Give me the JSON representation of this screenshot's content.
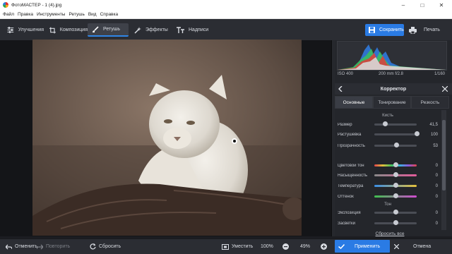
{
  "window": {
    "title": "ФотоМАСТЕР - 1 (4).jpg",
    "controls": [
      "–",
      "□",
      "✕"
    ]
  },
  "menu": [
    "Файл",
    "Правка",
    "Инструменты",
    "Ретушь",
    "Вид",
    "Справка"
  ],
  "toolbar": {
    "tabs": [
      {
        "label": "Улучшения",
        "icon": "enhance-icon",
        "active": false
      },
      {
        "label": "Композиция",
        "icon": "crop-icon",
        "active": false
      },
      {
        "label": "Ретушь",
        "icon": "brush-icon",
        "active": true
      },
      {
        "label": "Эффекты",
        "icon": "magic-wand-icon",
        "active": false
      },
      {
        "label": "Надписи",
        "icon": "text-icon",
        "active": false
      }
    ],
    "save_label": "Сохранить",
    "print_label": "Печать"
  },
  "photo_info": {
    "iso": "ISO 400",
    "lens": "200 mm f/2.8",
    "shutter": "1/160"
  },
  "panel": {
    "title": "Корректор",
    "subtabs": [
      {
        "label": "Основные",
        "active": true
      },
      {
        "label": "Тонирование",
        "active": false
      },
      {
        "label": "Резкость",
        "active": false
      }
    ],
    "section_brush": "Кисть",
    "brush_sliders": [
      {
        "label": "Размер",
        "value": "41,5",
        "level": 0.25
      },
      {
        "label": "Растушевка",
        "value": "100",
        "level": 1.0
      },
      {
        "label": "Прозрачность",
        "value": "53",
        "level": 0.53
      }
    ],
    "color_sliders": [
      {
        "label": "Цветовой тон",
        "value": "0",
        "level": 0.5,
        "gradient": "linear-gradient(90deg,#e0434b,#e0c13b,#44c05a,#3ab2e0,#8a5be0,#e0434b)"
      },
      {
        "label": "Насыщенность",
        "value": "0",
        "level": 0.5,
        "gradient": "linear-gradient(90deg,#8a8a8a,#e25c9a)"
      },
      {
        "label": "Температура",
        "value": "0",
        "level": 0.5,
        "gradient": "linear-gradient(90deg,#3a8ee6,#e6c13a)"
      },
      {
        "label": "Оттенок",
        "value": "0",
        "level": 0.5,
        "gradient": "linear-gradient(90deg,#3fc04e,#d04ad0)"
      }
    ],
    "section_tone": "Тон",
    "tone_sliders": [
      {
        "label": "Экспозиция",
        "value": "0",
        "level": 0.5
      },
      {
        "label": "Засветки",
        "value": "0",
        "level": 0.5
      }
    ],
    "reset_all": "Сбросить все"
  },
  "bottom": {
    "undo": "Отменить",
    "redo": "Повторить",
    "reset": "Сбросить",
    "fit": "Уместить",
    "zoom_100": "100%",
    "zoom_value": "49%",
    "apply": "Применить",
    "cancel": "Отмена"
  },
  "colors": {
    "accent": "#2a7be4",
    "bg": "#1c1d21",
    "panel": "#24262b"
  }
}
